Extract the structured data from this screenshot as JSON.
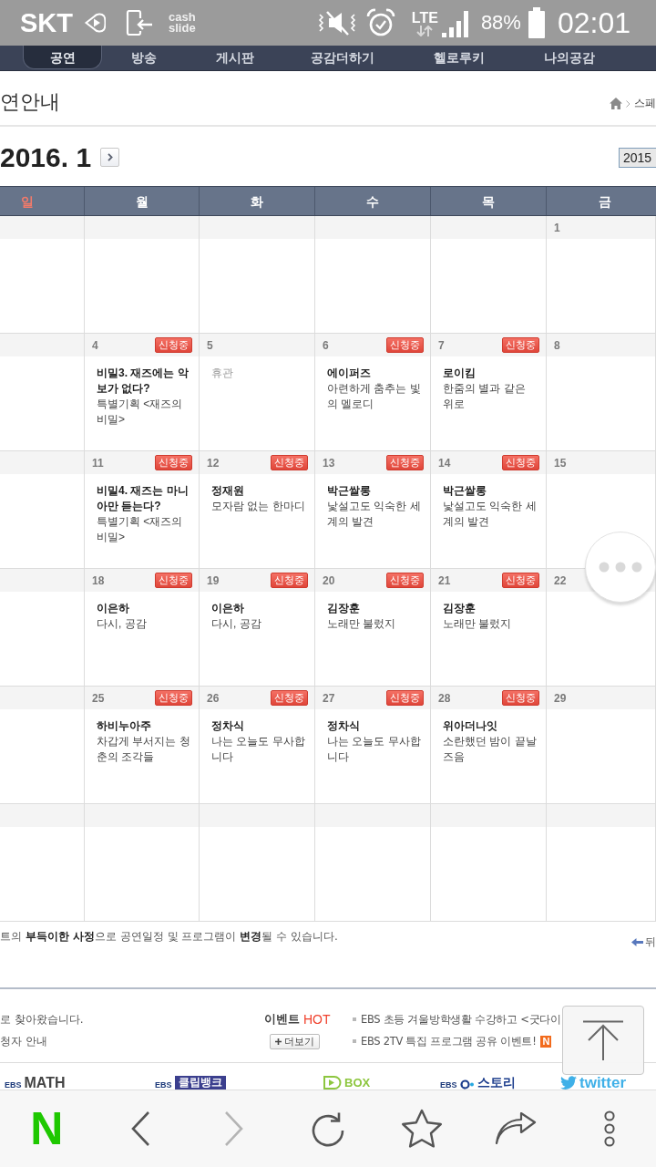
{
  "status_bar": {
    "carrier": "SKT",
    "app_label": "cash slide",
    "network": "LTE",
    "battery": "88%",
    "time": "02:01"
  },
  "nav": {
    "tabs": [
      {
        "label": "공연",
        "selected": true
      },
      {
        "label": "방송",
        "selected": false
      },
      {
        "label": "게시판",
        "selected": false
      },
      {
        "label": "공감더하기",
        "selected": false
      },
      {
        "label": "헬로루키",
        "selected": false
      },
      {
        "label": "나의공감",
        "selected": false
      }
    ]
  },
  "page_header": {
    "title": "연안내",
    "breadcrumb": "스페"
  },
  "calendar": {
    "month": "2016. 1",
    "year_select": "2015",
    "weekdays": [
      {
        "label": "일",
        "color": "#f47a6a"
      },
      {
        "label": "월",
        "color": "#ffffff"
      },
      {
        "label": "화",
        "color": "#ffffff"
      },
      {
        "label": "수",
        "color": "#ffffff"
      },
      {
        "label": "목",
        "color": "#ffffff"
      },
      {
        "label": "금",
        "color": "#ffffff"
      }
    ],
    "weeks": [
      {
        "days": [
          {
            "kind": "empty"
          },
          {
            "kind": "empty"
          },
          {
            "kind": "empty"
          },
          {
            "kind": "empty"
          },
          {
            "kind": "empty"
          },
          {
            "kind": "day",
            "date": "1"
          }
        ]
      },
      {
        "days": [
          {
            "kind": "empty"
          },
          {
            "kind": "day",
            "date": "4",
            "badge": "신청중",
            "title": "비밀3. 재즈에는 악보가 없다?",
            "subtitle": "특별기획 <재즈의 비밀>"
          },
          {
            "kind": "day",
            "date": "5",
            "note": "휴관"
          },
          {
            "kind": "day",
            "date": "6",
            "badge": "신청중",
            "title": "에이퍼즈",
            "subtitle": "아련하게 춤추는 빛의 멜로디"
          },
          {
            "kind": "day",
            "date": "7",
            "badge": "신청중",
            "title": "로이킴",
            "subtitle": "한줌의 별과 같은 위로"
          },
          {
            "kind": "day",
            "date": "8"
          }
        ]
      },
      {
        "days": [
          {
            "kind": "empty"
          },
          {
            "kind": "day",
            "date": "11",
            "badge": "신청중",
            "title": "비밀4. 재즈는 마니아만 듣는다?",
            "subtitle": "특별기획 <재즈의 비밀>"
          },
          {
            "kind": "day",
            "date": "12",
            "badge": "신청중",
            "title": "정재원",
            "subtitle": "모자람 없는 한마디"
          },
          {
            "kind": "day",
            "date": "13",
            "badge": "신청중",
            "title": "박근쌀롱",
            "subtitle": "낯설고도 익숙한 세계의 발견"
          },
          {
            "kind": "day",
            "date": "14",
            "badge": "신청중",
            "title": "박근쌀롱",
            "subtitle": "낯설고도 익숙한 세계의 발견"
          },
          {
            "kind": "day",
            "date": "15"
          }
        ]
      },
      {
        "days": [
          {
            "kind": "empty"
          },
          {
            "kind": "day",
            "date": "18",
            "badge": "신청중",
            "title": "이은하",
            "subtitle": "다시, 공감"
          },
          {
            "kind": "day",
            "date": "19",
            "badge": "신청중",
            "title": "이은하",
            "subtitle": "다시, 공감"
          },
          {
            "kind": "day",
            "date": "20",
            "badge": "신청중",
            "title": "김장훈",
            "subtitle": "노래만 불렀지"
          },
          {
            "kind": "day",
            "date": "21",
            "badge": "신청중",
            "title": "김장훈",
            "subtitle": "노래만 불렀지"
          },
          {
            "kind": "day",
            "date": "22"
          }
        ]
      },
      {
        "days": [
          {
            "kind": "empty"
          },
          {
            "kind": "day",
            "date": "25",
            "badge": "신청중",
            "title": "하비누아주",
            "subtitle": "차갑게 부서지는 청춘의 조각들"
          },
          {
            "kind": "day",
            "date": "26",
            "badge": "신청중",
            "title": "정차식",
            "subtitle": "나는 오늘도 무사합니다"
          },
          {
            "kind": "day",
            "date": "27",
            "badge": "신청중",
            "title": "정차식",
            "subtitle": "나는 오늘도 무사합니다"
          },
          {
            "kind": "day",
            "date": "28",
            "badge": "신청중",
            "title": "위아더나잇",
            "subtitle": "소란했던 밤이 끝날 즈음"
          },
          {
            "kind": "day",
            "date": "29"
          }
        ]
      },
      {
        "days": [
          {
            "kind": "empty"
          },
          {
            "kind": "empty"
          },
          {
            "kind": "empty"
          },
          {
            "kind": "empty"
          },
          {
            "kind": "empty"
          },
          {
            "kind": "empty"
          }
        ]
      }
    ]
  },
  "notice": {
    "text": "트의 **부득이한 사정**으로 공연일정 및 프로그램이 **변경**될 수 있습니다.",
    "link": "뒤"
  },
  "footer": {
    "notices": [
      "로 찾아왔습니다.",
      "청자 안내"
    ],
    "event_title": "이벤트",
    "event_hot": "HOT",
    "more_button": "더보기",
    "events": [
      {
        "text": "EBS 초등 겨울방학생활 수강하고 <굿다이"
      },
      {
        "text": "EBS 2TV 특집 프로그램 공유 이벤트!",
        "badge": "N"
      }
    ],
    "logos": [
      {
        "kind": "plain",
        "prefix": "EBS",
        "label": "MATH"
      },
      {
        "kind": "tile",
        "prefix": "EBS",
        "label": "클립뱅크"
      },
      {
        "kind": "play",
        "label": "BOX"
      },
      {
        "kind": "dot",
        "prefix": "EBS",
        "label": "스토리"
      },
      {
        "kind": "bird",
        "label": "twitter"
      }
    ]
  },
  "browser_toolbar": {
    "logo": "N",
    "forward_disabled": true
  }
}
